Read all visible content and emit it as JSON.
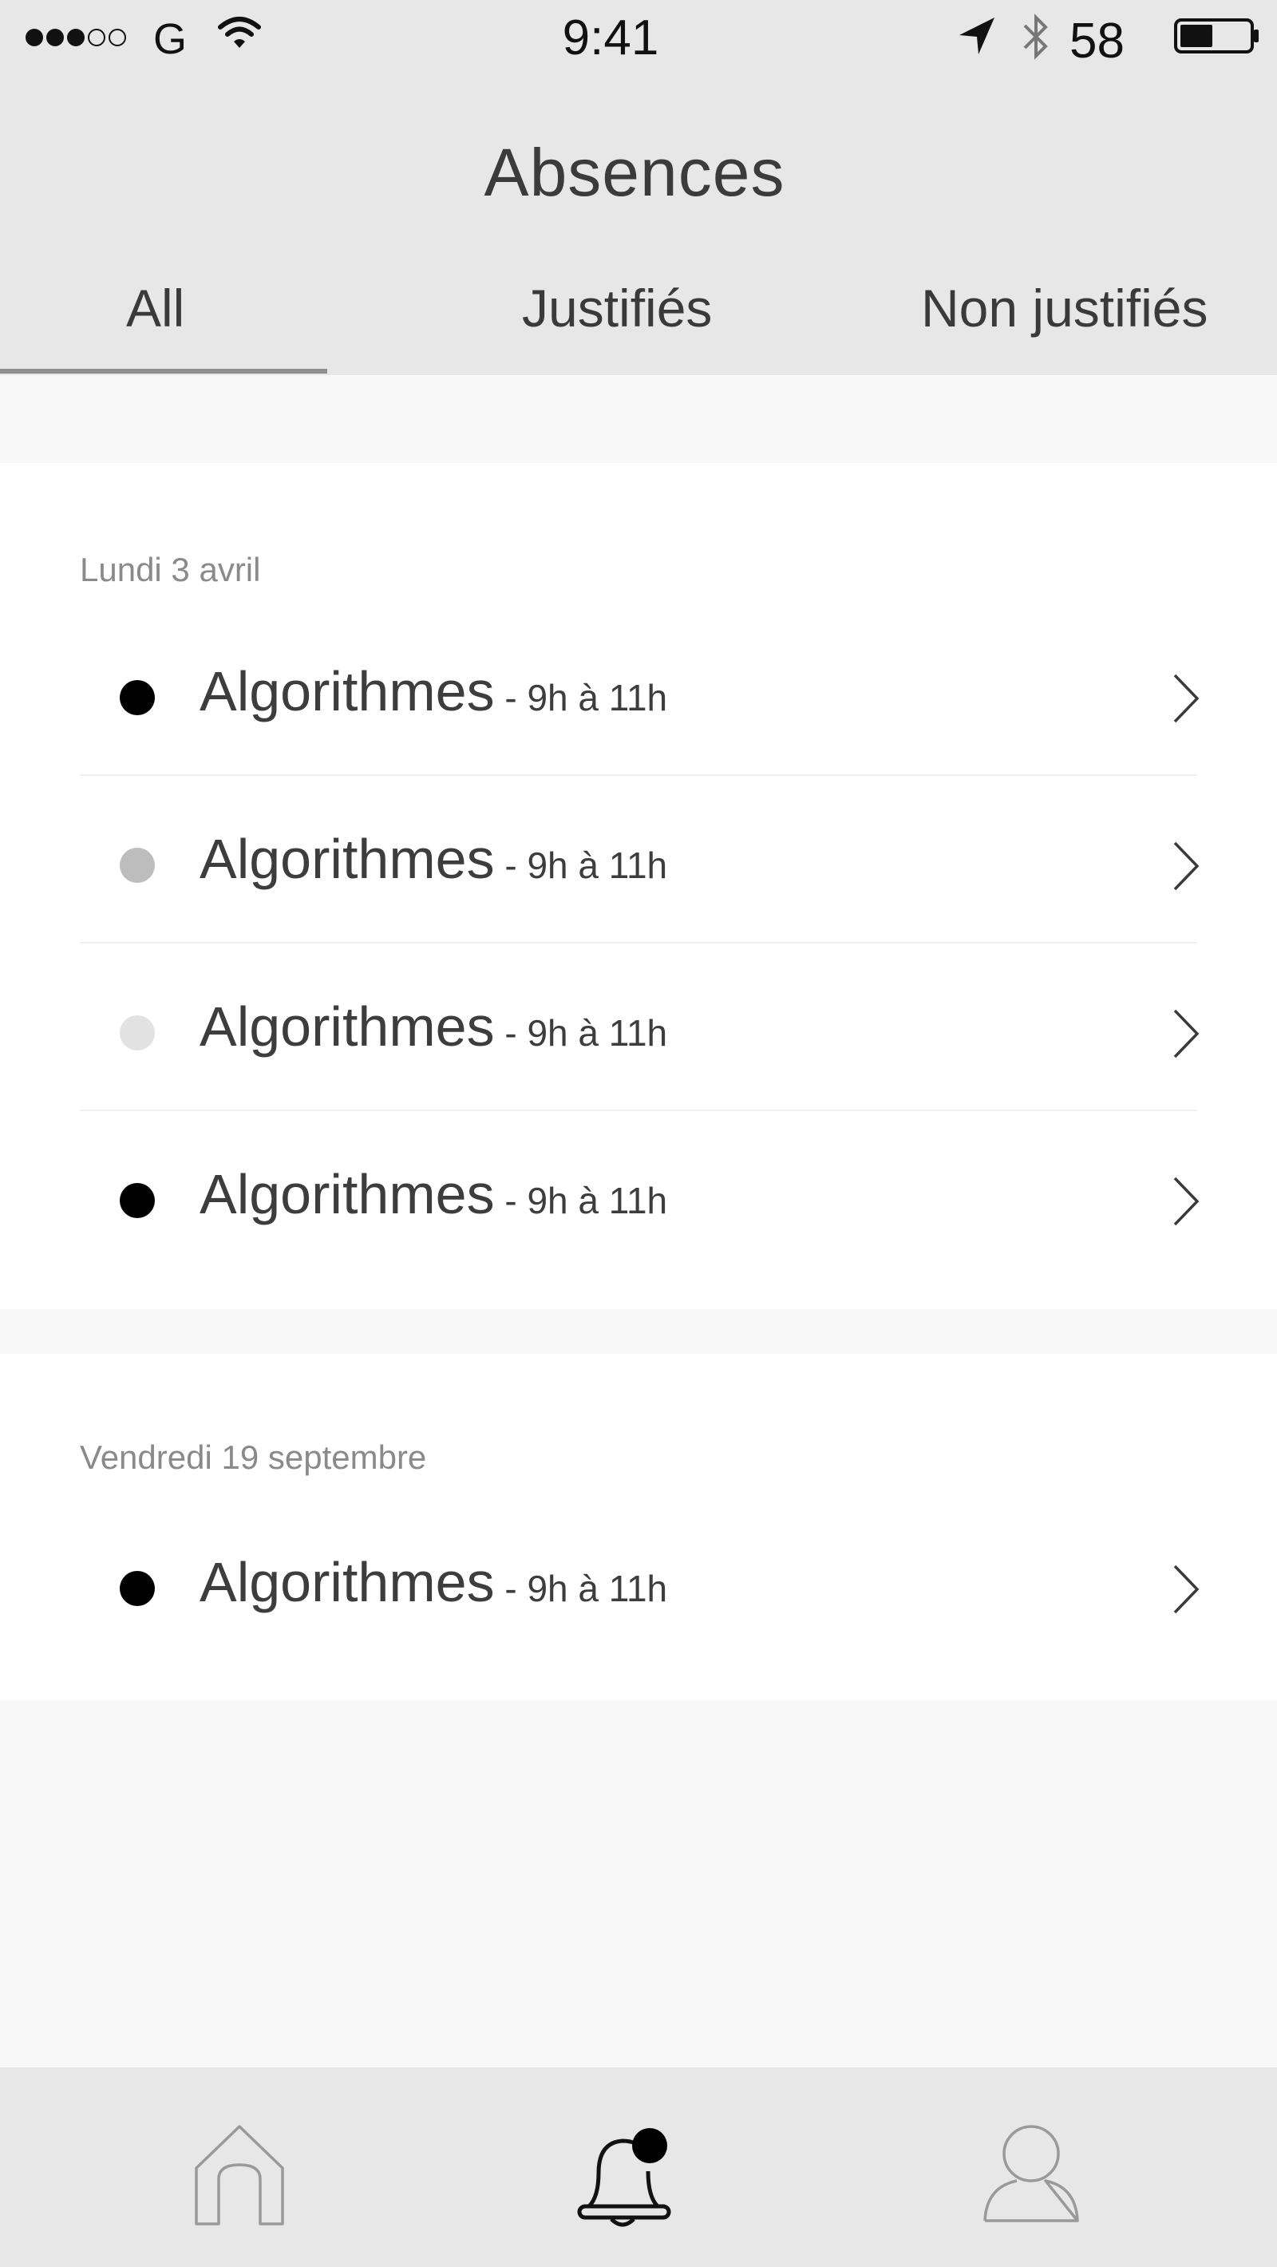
{
  "status_bar": {
    "carrier": "G",
    "time": "9:41",
    "battery_percent": "58",
    "signal_bars_filled": 3,
    "signal_bars_total": 5
  },
  "header": {
    "title": "Absences"
  },
  "tabs": [
    {
      "label": "All",
      "selected": true
    },
    {
      "label": "Justifiés",
      "selected": false
    },
    {
      "label": "Non justifiés",
      "selected": false
    }
  ],
  "sections": [
    {
      "date": "Lundi 3 avril",
      "items": [
        {
          "course": "Algorithmes",
          "time": " - 9h à 11h",
          "status_color": "#000000"
        },
        {
          "course": "Algorithmes",
          "time": " - 9h à 11h",
          "status_color": "#bdbdbd"
        },
        {
          "course": "Algorithmes",
          "time": " - 9h à 11h",
          "status_color": "#e2e2e2"
        },
        {
          "course": "Algorithmes",
          "time": " - 9h à 11h",
          "status_color": "#000000"
        }
      ]
    },
    {
      "date": "Vendredi 19 septembre",
      "items": [
        {
          "course": "Algorithmes",
          "time": " - 9h à 11h",
          "status_color": "#000000"
        }
      ]
    }
  ],
  "tab_bar": [
    {
      "icon": "home-icon",
      "selected": false
    },
    {
      "icon": "bell-icon",
      "selected": true,
      "badge": true
    },
    {
      "icon": "profile-icon",
      "selected": false
    }
  ]
}
